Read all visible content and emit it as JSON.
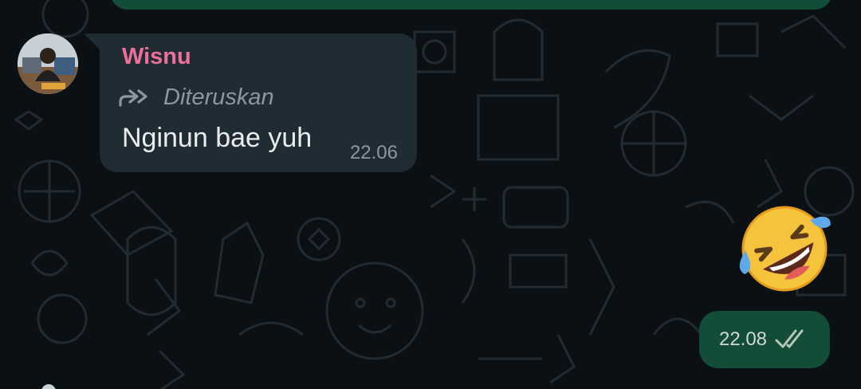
{
  "theme": {
    "background": "#0b1014",
    "incoming_bubble": "#1f2c33",
    "outgoing_bubble": "#134d37",
    "sender_color": "#ef6f9c",
    "meta_text": "#8d979d",
    "message_text": "#e9edef"
  },
  "incoming_message": {
    "sender": "Wisnu",
    "forwarded_label": "Diteruskan",
    "forwarded_icon": "forward-double-arrow-icon",
    "text": "Nginun bae yuh",
    "time": "22.06"
  },
  "outgoing_sticker": {
    "emoji_name": "rolling-on-floor-laughing",
    "emoji": "🤣"
  },
  "outgoing_message": {
    "time": "22.08",
    "status_icon": "double-check-read-icon"
  }
}
